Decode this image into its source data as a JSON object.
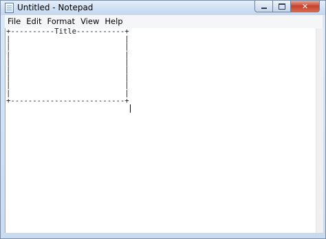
{
  "window": {
    "title": "Untitled - Notepad",
    "icon": "notepad-icon"
  },
  "caption_buttons": {
    "minimize_icon": "minimize-icon",
    "maximize_icon": "maximize-icon",
    "close_label": "✕"
  },
  "menu": {
    "items": [
      "File",
      "Edit",
      "Format",
      "View",
      "Help"
    ]
  },
  "editor": {
    "content": "+----------Title-----------+\n|                          |\n|                          |\n|                          |\n|                          |\n|                          |\n|                          |\n|                          |\n|                          |\n+--------------------------+"
  },
  "colors": {
    "titlebar": "#cfe0f3",
    "close_button": "#c8412b",
    "menubar": "#f5f6f7",
    "editor_bg": "#ffffff"
  }
}
